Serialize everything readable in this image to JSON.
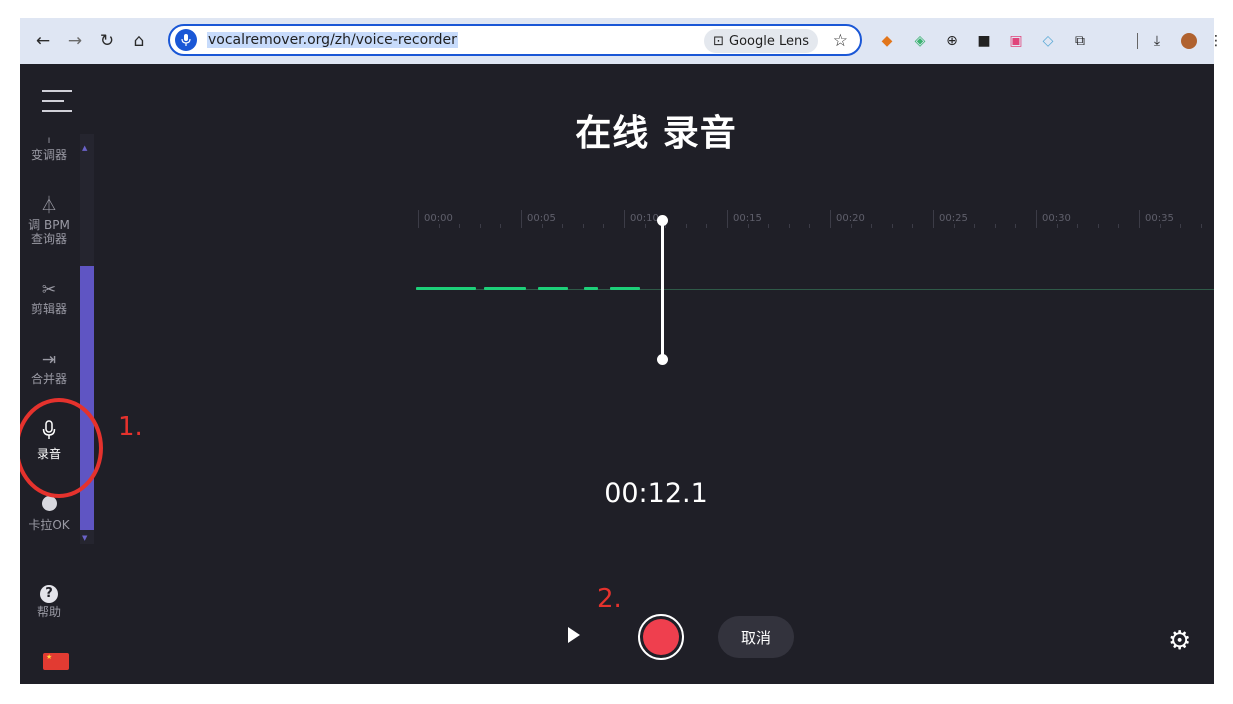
{
  "browser": {
    "url": "vocalremover.org/zh/voice-recorder",
    "lens_label": "Google Lens"
  },
  "sidebar": {
    "items": [
      {
        "id": "pitch",
        "label": "变调器",
        "icon": "waveform-icon"
      },
      {
        "id": "bpm",
        "label": "调 BPM\n查询器",
        "icon": "metronome-icon"
      },
      {
        "id": "cutter",
        "label": "剪辑器",
        "icon": "scissors-icon"
      },
      {
        "id": "joiner",
        "label": "合并器",
        "icon": "merge-icon"
      },
      {
        "id": "recorder",
        "label": "录音",
        "icon": "microphone-icon",
        "active": true
      },
      {
        "id": "karaoke",
        "label": "卡拉OK",
        "icon": "disc-icon"
      }
    ],
    "help_label": "帮助"
  },
  "main": {
    "title": "在线 录音",
    "timeline_ticks": [
      "00:00",
      "00:05",
      "00:10",
      "00:15",
      "00:20",
      "00:25",
      "00:30",
      "00:35"
    ],
    "elapsed": "00:12.1",
    "cancel_label": "取消"
  },
  "annotations": {
    "step1": "1.",
    "step2": "2."
  },
  "colors": {
    "app_bg": "#1f1f27",
    "accent": "#5f55c3",
    "record": "#ef3f4e",
    "waveform": "#1dcf79",
    "annotation": "#e5322d"
  }
}
